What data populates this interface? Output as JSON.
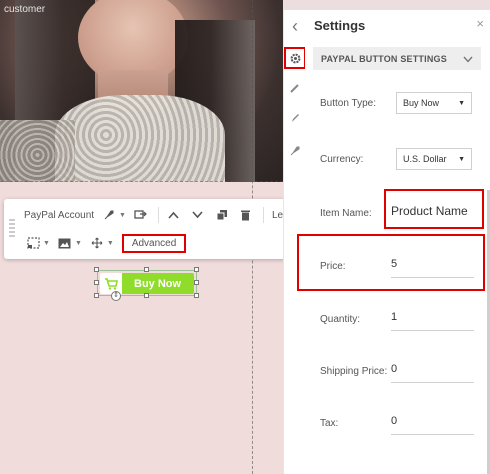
{
  "canvas": {
    "photo_caption": "customer"
  },
  "toolbar": {
    "account_label": "PayPal Account",
    "less_label": "Less",
    "advanced_label": "Advanced",
    "icons": [
      "rocket-icon",
      "link-icon",
      "chevron-up-icon",
      "chevron-down-icon",
      "duplicate-icon",
      "trash-icon",
      "select-icon",
      "image-icon",
      "move-icon"
    ]
  },
  "buy_button": {
    "label": "Buy Now",
    "color": "#8fdc2b"
  },
  "rail": {
    "back_glyph": "‹",
    "items": [
      "gear-icon",
      "pencil-icon",
      "brush-icon",
      "rocket-icon"
    ]
  },
  "settings": {
    "title": "Settings",
    "close_glyph": "×",
    "section_title": "PAYPAL BUTTON SETTINGS",
    "fields": {
      "button_type": {
        "label": "Button Type:",
        "value": "Buy Now"
      },
      "currency": {
        "label": "Currency:",
        "value": "U.S. Dollar"
      },
      "item_name": {
        "label": "Item Name:",
        "value": "Product Name"
      },
      "price": {
        "label": "Price:",
        "value": "5"
      },
      "quantity": {
        "label": "Quantity:",
        "value": "1"
      },
      "shipping_price": {
        "label": "Shipping Price:",
        "value": "0"
      },
      "tax": {
        "label": "Tax:",
        "value": "0"
      }
    }
  },
  "colors": {
    "highlight": "#e00000",
    "canvas_bg": "#f1dcdc"
  }
}
